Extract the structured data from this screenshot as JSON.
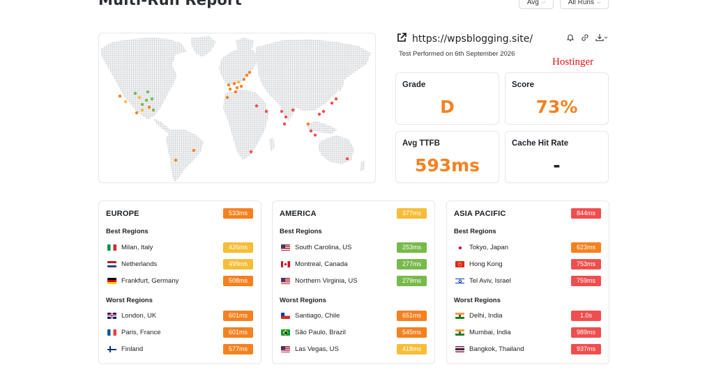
{
  "header": {
    "title": "Multi-Run Report",
    "avg_label": "Avg",
    "runs_label": "All Runs"
  },
  "report": {
    "url": "https://wpsblogging.site/",
    "test_date": "Test Performed on 6th September 2026",
    "host": "Hostinger"
  },
  "metrics": {
    "grade_label": "Grade",
    "grade_value": "D",
    "score_label": "Score",
    "score_value": "73%",
    "ttfb_label": "Avg TTFB",
    "ttfb_value": "593ms",
    "cache_label": "Cache Hit Rate",
    "cache_value": "-"
  },
  "colors": {
    "orange": "#f48120",
    "yellow": "#f6bd37",
    "green": "#78b94c",
    "red": "#ef4e4e",
    "map_land": "#cfd3d6"
  },
  "regions": [
    {
      "title": "EUROPE",
      "avg": "533ms",
      "best_label": "Best Regions",
      "worst_label": "Worst Regions",
      "best": [
        {
          "flag": "it",
          "name": "Milan, Italy",
          "ttfb": "426ms",
          "status": "yellow"
        },
        {
          "flag": "nl",
          "name": "Netherlands",
          "ttfb": "499ms",
          "status": "yellow"
        },
        {
          "flag": "de",
          "name": "Frankfurt, Germany",
          "ttfb": "508ms",
          "status": "orange"
        }
      ],
      "worst": [
        {
          "flag": "gb",
          "name": "London, UK",
          "ttfb": "601ms",
          "status": "orange"
        },
        {
          "flag": "fr",
          "name": "Paris, France",
          "ttfb": "601ms",
          "status": "orange"
        },
        {
          "flag": "fi",
          "name": "Finland",
          "ttfb": "577ms",
          "status": "orange"
        }
      ]
    },
    {
      "title": "AMERICA",
      "avg": "377ms",
      "best_label": "Best Regions",
      "worst_label": "Worst Regions",
      "best": [
        {
          "flag": "us",
          "name": "South Carolina, US",
          "ttfb": "253ms",
          "status": "green"
        },
        {
          "flag": "ca",
          "name": "Montreal, Canada",
          "ttfb": "277ms",
          "status": "green"
        },
        {
          "flag": "us",
          "name": "Northern Virginia, US",
          "ttfb": "279ms",
          "status": "green"
        }
      ],
      "worst": [
        {
          "flag": "cl",
          "name": "Santiago, Chile",
          "ttfb": "651ms",
          "status": "orange"
        },
        {
          "flag": "br",
          "name": "São Paulo, Brazil",
          "ttfb": "545ms",
          "status": "orange"
        },
        {
          "flag": "us",
          "name": "Las Vegas, US",
          "ttfb": "418ms",
          "status": "yellow"
        }
      ]
    },
    {
      "title": "ASIA PACIFIC",
      "avg": "844ms",
      "best_label": "Best Regions",
      "worst_label": "Worst Regions",
      "best": [
        {
          "flag": "jp",
          "name": "Tokyo, Japan",
          "ttfb": "623ms",
          "status": "orange"
        },
        {
          "flag": "hk",
          "name": "Hong Kong",
          "ttfb": "753ms",
          "status": "red"
        },
        {
          "flag": "il",
          "name": "Tel Aviv, Israel",
          "ttfb": "759ms",
          "status": "red"
        }
      ],
      "worst": [
        {
          "flag": "in",
          "name": "Delhi, India",
          "ttfb": "1.0s",
          "status": "red"
        },
        {
          "flag": "in",
          "name": "Mumbai, India",
          "ttfb": "989ms",
          "status": "red"
        },
        {
          "flag": "th",
          "name": "Bangkok, Thailand",
          "ttfb": "937ms",
          "status": "red"
        }
      ]
    }
  ]
}
